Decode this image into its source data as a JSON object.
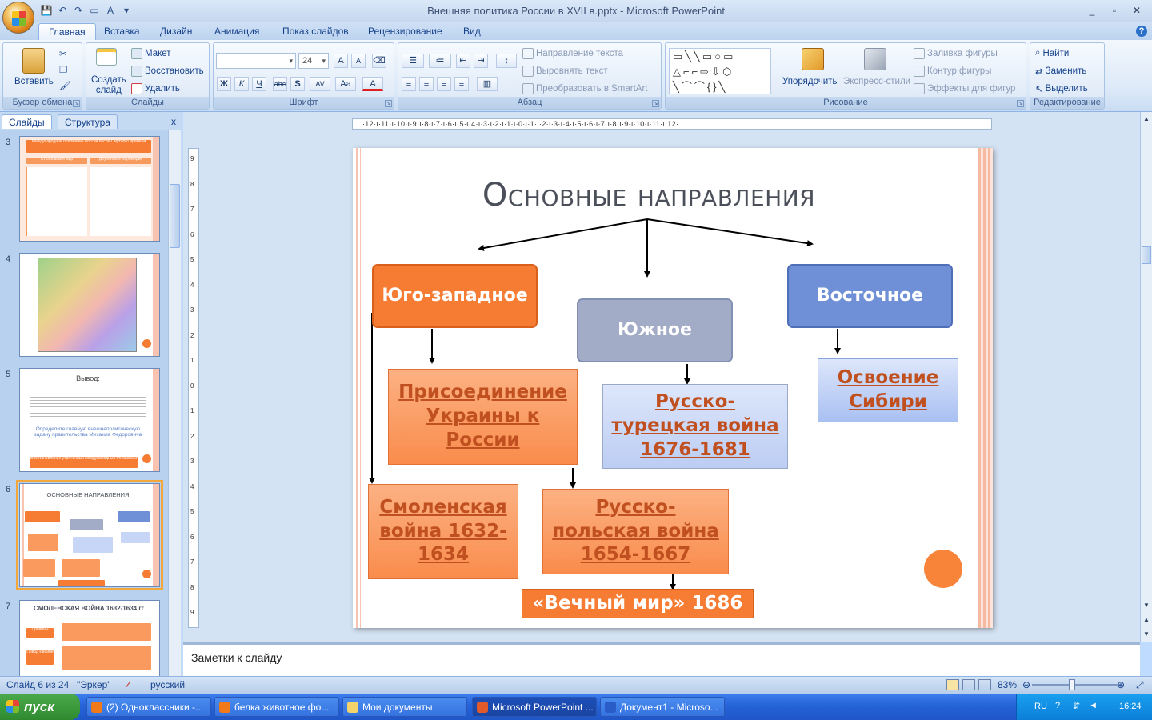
{
  "window": {
    "title": "Внешняя политика России в XVII в.pptx - Microsoft PowerPoint",
    "min": "_",
    "max": "▫",
    "close": "✕"
  },
  "tabs": [
    "Главная",
    "Вставка",
    "Дизайн",
    "Анимация",
    "Показ слайдов",
    "Рецензирование",
    "Вид"
  ],
  "ribbon": {
    "clipboard": {
      "label": "Буфер обмена",
      "paste": "Вставить"
    },
    "slides": {
      "label": "Слайды",
      "new_slide": "Создать слайд",
      "layout": "Макет",
      "reset": "Восстановить",
      "delete": "Удалить"
    },
    "font": {
      "label": "Шрифт",
      "size": "24",
      "bold": "Ж",
      "italic": "К",
      "underline": "Ч",
      "strike": "abc",
      "shadow": "S",
      "spacing": "AV",
      "case": "Aa",
      "color": "A",
      "grow": "A",
      "shrink": "A"
    },
    "paragraph": {
      "label": "Абзац",
      "text_direction": "Направление текста",
      "align_text": "Выровнять текст",
      "smartart": "Преобразовать в SmartArt"
    },
    "drawing": {
      "label": "Рисование",
      "arrange": "Упорядочить",
      "quick_styles": "Экспресс-стили",
      "fill": "Заливка фигуры",
      "outline": "Контур фигуры",
      "effects": "Эффекты для фигур"
    },
    "editing": {
      "label": "Редактирование",
      "find": "Найти",
      "replace": "Заменить",
      "select": "Выделить"
    }
  },
  "left_panel": {
    "tab_slides": "Слайды",
    "tab_outline": "Структура",
    "close": "x"
  },
  "thumbnails": [
    {
      "num": "3",
      "title": "Международное положение России после Смутного времени",
      "left": "Столбовский мир",
      "right": "Деулинское перемирие"
    },
    {
      "num": "4"
    },
    {
      "num": "5",
      "title": "Вывод:",
      "question": "Определите главную внешнеполитическую задачу правительства Михаила Федоровича",
      "answer": "Восстановление утраченных международных отношений"
    },
    {
      "num": "6",
      "title": "ОСНОВНЫЕ НАПРАВЛЕНИЯ"
    },
    {
      "num": "7",
      "title": "СМОЛЕНСКАЯ ВОЙНА 1632-1634 гг",
      "cause": "Причины",
      "pretext": "Повод к войне"
    }
  ],
  "ruler": {
    "h_labels": "·12·ı·11·ı·10·ı·9·ı·8·ı·7·ı·6·ı·5·ı·4·ı·3·ı·2·ı·1·ı·0·ı·1·ı·2·ı·3·ı·4·ı·5·ı·6·ı·7·ı·8·ı·9·ı·10·ı·11·ı·12·",
    "v_labels": [
      "9",
      "8",
      "7",
      "6",
      "5",
      "4",
      "3",
      "2",
      "1",
      "0",
      "1",
      "2",
      "3",
      "4",
      "5",
      "6",
      "7",
      "8",
      "9"
    ]
  },
  "slide": {
    "title": "Основные направления",
    "sw": "Юго-западное",
    "south": "Южное",
    "east": "Восточное",
    "ukraine": "Присоединение Украины к России",
    "turkish_war": "Русско-турецкая война 1676-1681",
    "siberia": "Освоение Сибири",
    "smolensk": "Смоленская война 1632-1634",
    "polish_war": "Русско-польская война 1654-1667",
    "eternal_peace": "«Вечный мир» 1686"
  },
  "notes": {
    "placeholder": "Заметки к слайду"
  },
  "status": {
    "slide": "Слайд 6 из 24",
    "theme": "\"Эркер\"",
    "lang": "русский",
    "zoom": "83%",
    "zoom_level": 0.45
  },
  "taskbar": {
    "start": "пуск",
    "items": [
      "(2) Одноклассники -...",
      "белка животное фо...",
      "Мои документы",
      "Microsoft PowerPoint ...",
      "Документ1 - Microso..."
    ],
    "lang": "RU",
    "time": "16:24"
  },
  "colors": {
    "orange": "#f57c32",
    "slate": "#a3acc7",
    "blue": "#6f8fd6",
    "peach": "#fb9a5f",
    "light_blue": "#c7d6f6"
  }
}
